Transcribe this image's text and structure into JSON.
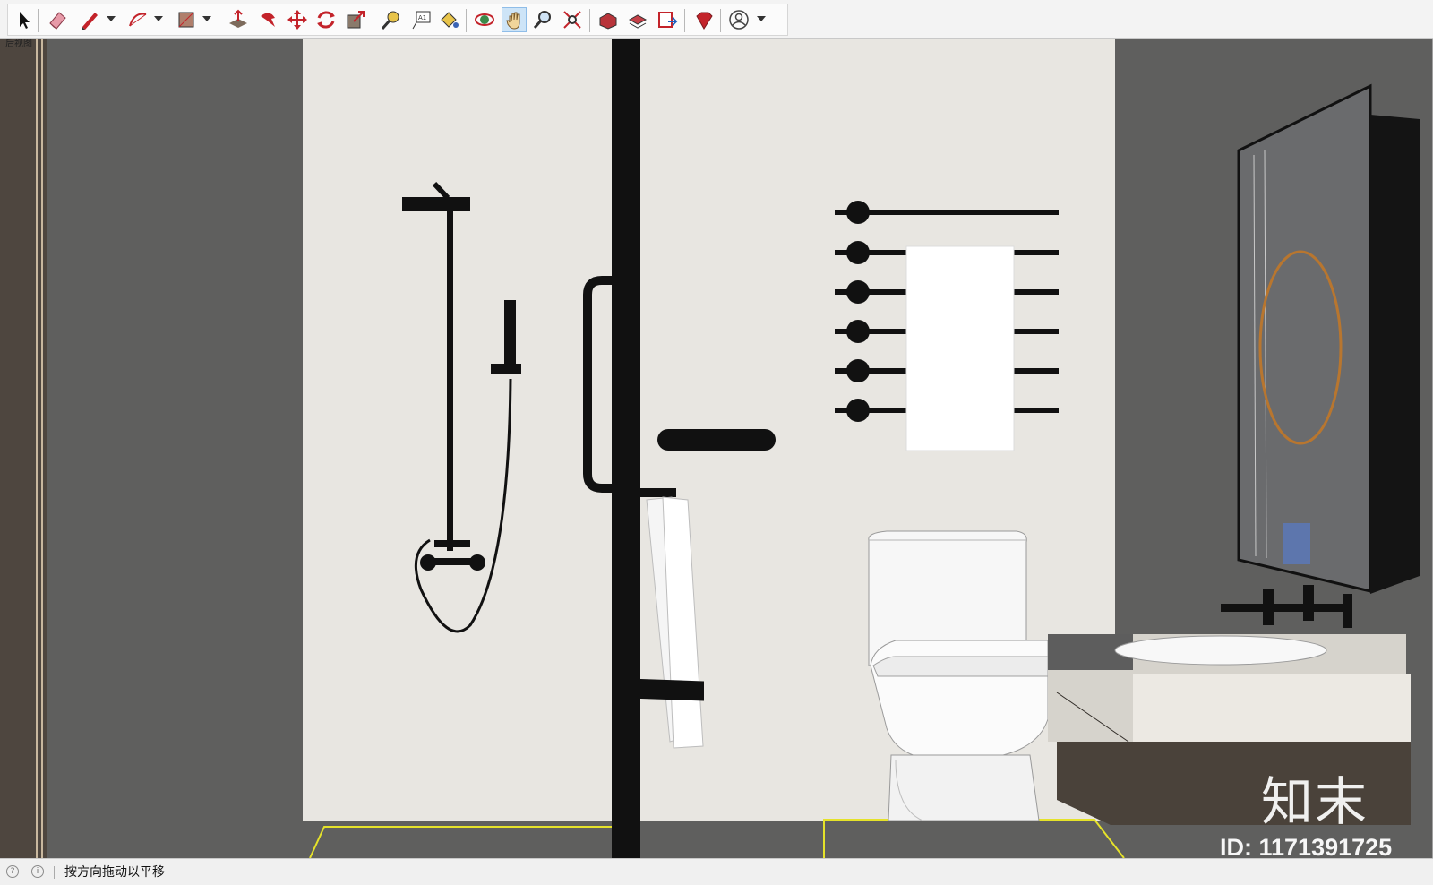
{
  "toolbar": {
    "tools": [
      {
        "name": "select-tool",
        "icon": "arrow-cursor-icon"
      },
      {
        "name": "eraser-tool",
        "icon": "eraser-icon"
      },
      {
        "name": "line-tool",
        "icon": "pencil-icon"
      },
      {
        "name": "arc-tool",
        "icon": "arc-icon"
      },
      {
        "name": "rectangle-tool",
        "icon": "rectangle-icon"
      },
      {
        "name": "push-pull-tool",
        "icon": "push-pull-icon"
      },
      {
        "name": "follow-me-tool",
        "icon": "follow-me-icon"
      },
      {
        "name": "move-tool",
        "icon": "move-icon"
      },
      {
        "name": "rotate-tool",
        "icon": "rotate-icon"
      },
      {
        "name": "scale-tool",
        "icon": "scale-icon"
      },
      {
        "name": "tape-measure-tool",
        "icon": "tape-measure-icon"
      },
      {
        "name": "text-tool",
        "icon": "text-icon"
      },
      {
        "name": "paint-bucket-tool",
        "icon": "paint-bucket-icon"
      },
      {
        "name": "orbit-tool",
        "icon": "orbit-icon"
      },
      {
        "name": "pan-tool",
        "icon": "hand-icon"
      },
      {
        "name": "zoom-tool",
        "icon": "magnifier-icon"
      },
      {
        "name": "zoom-extents-tool",
        "icon": "zoom-extents-icon"
      },
      {
        "name": "3d-warehouse",
        "icon": "warehouse-icon"
      },
      {
        "name": "extension-warehouse",
        "icon": "extension-warehouse-icon"
      },
      {
        "name": "send-to-layout",
        "icon": "layout-icon"
      },
      {
        "name": "ruby-console",
        "icon": "ruby-icon"
      },
      {
        "name": "account-menu",
        "icon": "user-icon"
      }
    ],
    "active_tool": "pan-tool"
  },
  "viewport": {
    "view_label": "后视图",
    "watermark_logo": "知末",
    "watermark_id": "ID: 1171391725",
    "colors": {
      "wall_dark": "#5f5f5e",
      "wall_light": "#e8e6e1",
      "fixture_black": "#111111",
      "floor_line": "#e5e22a",
      "mirror_glass": "#6a6b6d",
      "mirror_ring": "#b8762f",
      "vanity_wood": "#4a423a"
    }
  },
  "statusbar": {
    "text": "按方向拖动以平移"
  }
}
